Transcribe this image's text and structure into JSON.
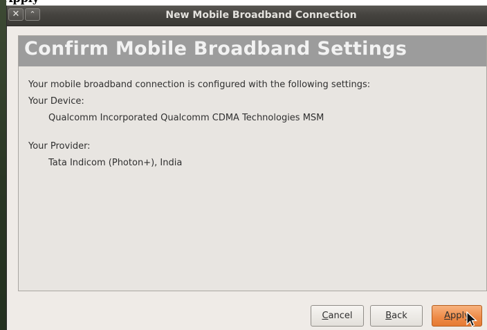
{
  "caption": "Apply",
  "window": {
    "title": "New Mobile Broadband Connection",
    "close_glyph": "✕",
    "maximize_glyph": "⌃"
  },
  "page": {
    "heading": "Confirm Mobile Broadband Settings",
    "intro": "Your mobile broadband connection is configured with the following settings:",
    "device_label": "Your Device:",
    "device_value": "Qualcomm Incorporated Qualcomm CDMA Technologies MSM",
    "provider_label": "Your Provider:",
    "provider_value": "Tata Indicom (Photon+), India"
  },
  "buttons": {
    "cancel_mnemonic": "C",
    "cancel_rest": "ancel",
    "back_mnemonic": "B",
    "back_rest": "ack",
    "apply_mnemonic": "A",
    "apply_rest": "pply"
  },
  "colors": {
    "header_band": "#9c9c9c",
    "apply_accent": "#ee8a46",
    "titlebar": "#45433f"
  }
}
